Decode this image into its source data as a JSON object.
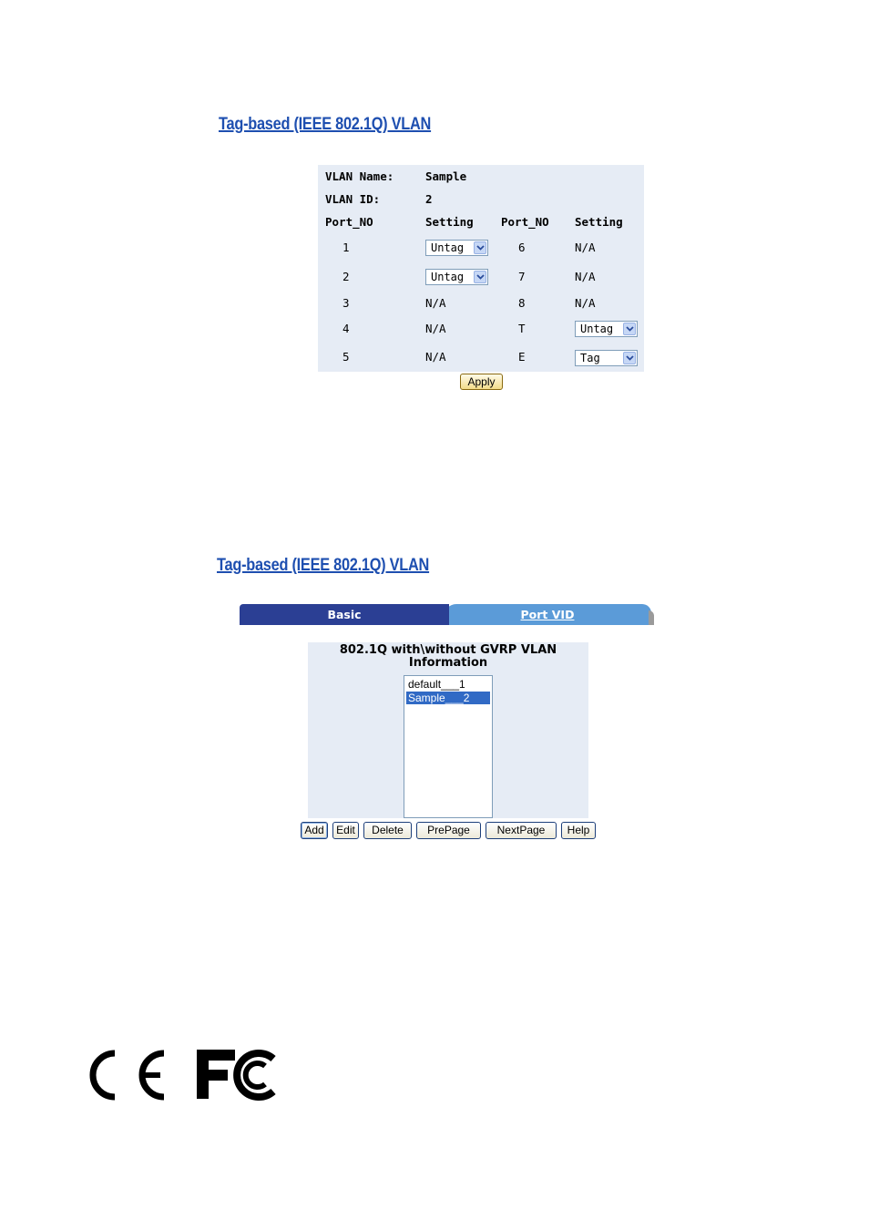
{
  "headings": {
    "top": "Tag-based (IEEE 802.1Q) VLAN",
    "bottom": "Tag-based (IEEE 802.1Q) VLAN"
  },
  "vlan_edit": {
    "name_label": "VLAN Name:",
    "name_value": "Sample",
    "id_label": "VLAN ID:",
    "id_value": "2",
    "col_port": "Port_NO",
    "col_setting": "Setting",
    "left_ports": [
      {
        "port": "1",
        "setting": "Untag",
        "editable": true
      },
      {
        "port": "2",
        "setting": "Untag",
        "editable": true
      },
      {
        "port": "3",
        "setting": "N/A",
        "editable": false
      },
      {
        "port": "4",
        "setting": "N/A",
        "editable": false
      },
      {
        "port": "5",
        "setting": "N/A",
        "editable": false
      }
    ],
    "right_ports": [
      {
        "port": "6",
        "setting": "N/A",
        "editable": false
      },
      {
        "port": "7",
        "setting": "N/A",
        "editable": false
      },
      {
        "port": "8",
        "setting": "N/A",
        "editable": false
      },
      {
        "port": "T",
        "setting": "Untag",
        "editable": true
      },
      {
        "port": "E",
        "setting": "Tag",
        "editable": true
      }
    ],
    "apply_label": "Apply"
  },
  "tabs": {
    "basic": "Basic",
    "port_vid": "Port VID"
  },
  "vlan_list": {
    "title_line1": "802.1Q with\\without GVRP VLAN",
    "title_line2": "Information",
    "items": [
      "default___1",
      "Sample___2"
    ],
    "selected_index": 1,
    "buttons": {
      "add": "Add",
      "edit": "Edit",
      "delete": "Delete",
      "prepage": "PrePage",
      "nextpage": "NextPage",
      "help": "Help"
    }
  },
  "logos": [
    "CE",
    "FC"
  ],
  "colors": {
    "heading": "#1e4fb0",
    "panel_bg": "#e6ecf5",
    "tab_basic": "#2b3f94",
    "tab_portvid": "#5b9bd8",
    "list_selected": "#316ac5"
  }
}
